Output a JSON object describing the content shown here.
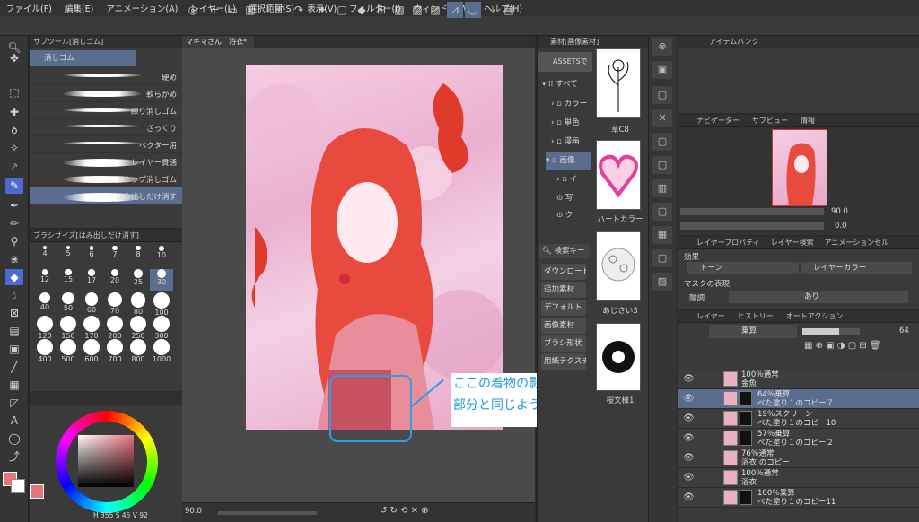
{
  "menu": [
    "ファイル(F)",
    "編集(E)",
    "アニメーション(A)",
    "レイヤー(L)",
    "選択範囲(S)",
    "表示(V)",
    "フィルター(I)",
    "ウィンドウ(W)",
    "ヘルプ(H)"
  ],
  "subtool": {
    "header": "サブツール[消しゴム]",
    "group": "消しゴム",
    "items": [
      "硬め",
      "軟らかめ",
      "練り消しゴム",
      "ざっくり",
      "ベクター用",
      "レイヤー貫通",
      "スナップ消しゴム",
      "はみ出しだけ消す"
    ]
  },
  "brush_size": {
    "header": "ブラシサイズ[はみ出しだけ消す]",
    "sizes": [
      "4",
      "5",
      "6",
      "7",
      "8",
      "10",
      "12",
      "15",
      "17",
      "20",
      "25",
      "30",
      "40",
      "50",
      "60",
      "70",
      "80",
      "100",
      "120",
      "150",
      "170",
      "200",
      "250",
      "300",
      "400",
      "500",
      "600",
      "700",
      "800",
      "1000"
    ],
    "selected": "30"
  },
  "color": {
    "readout": "H 355 S 45 V 92",
    "main": "#e8737d",
    "accent": "#4d6ad1"
  },
  "canvas": {
    "tab": "マキマさん　浴衣*",
    "zoom": "90.0",
    "callout_line1": "ここの着物の影を他の",
    "callout_line2": "部分と同じように塗る",
    "callout_color": "#1f9ae0"
  },
  "materials": {
    "header": "素材[画像素材]",
    "assets": "ASSETSで",
    "tree": [
      "すべて",
      "カラー",
      "単色",
      "漫画",
      "画像",
      "イ",
      "写",
      "ク"
    ],
    "buttons": [
      "ダウンロード",
      "追加素材",
      "デフォルト",
      "画像素材",
      "ブラシ形状",
      "用紙テクスチャ"
    ],
    "search_placeholder": "検索キー",
    "thumbs": [
      "草C8",
      "ハートカラー",
      "あじさい3",
      "桜文様1"
    ]
  },
  "item_bank": {
    "title": "アイテムバンク"
  },
  "navigator": {
    "tabs": [
      "ナビゲーター",
      "サブビュー",
      "情報"
    ],
    "zoom": "90.0",
    "angle": "0.0"
  },
  "layer_property": {
    "tabs": [
      "レイヤープロパティ",
      "レイヤー検索",
      "アニメーションセル"
    ],
    "effect_label": "効果",
    "tone": "トーン",
    "layer_color": "レイヤーカラー",
    "mask_label": "マスクの表現",
    "gradation_label": "階調",
    "gradation_value": "あり"
  },
  "layers": {
    "tabs": [
      "レイヤー",
      "ヒストリー",
      "オートアクション"
    ],
    "blend_mode": "乗算",
    "opacity": "64",
    "rows": [
      {
        "line1": "100％通常",
        "line2": "金魚",
        "selected": false,
        "double": false
      },
      {
        "line1": "64％乗算",
        "line2": "べた塗り１のコピー７",
        "selected": true,
        "double": true
      },
      {
        "line1": "19％スクリーン",
        "line2": "べた塗り１のコピー10",
        "selected": false,
        "double": true
      },
      {
        "line1": "57％乗算",
        "line2": "べた塗り１のコピー２",
        "selected": false,
        "double": true
      },
      {
        "line1": "76％通常",
        "line2": "浴衣 のコピー",
        "selected": false,
        "double": false
      },
      {
        "line1": "100％通常",
        "line2": "浴衣",
        "selected": false,
        "double": false
      },
      {
        "line1": "100％乗算",
        "line2": "べた塗り１のコピー11",
        "selected": false,
        "double": true
      }
    ]
  }
}
